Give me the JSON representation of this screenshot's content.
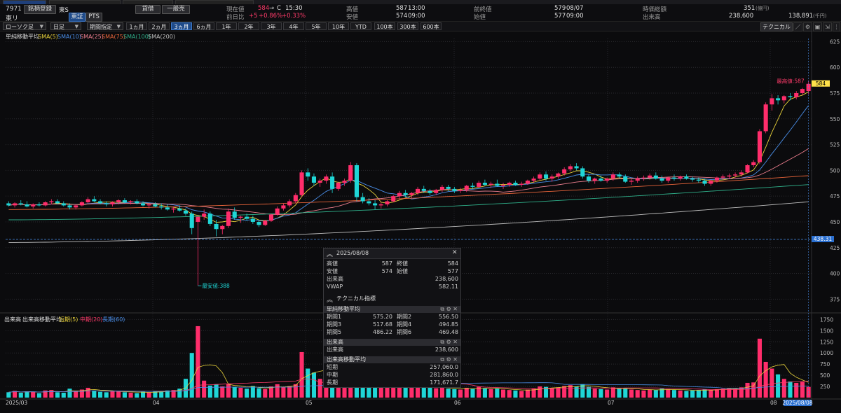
{
  "header": {
    "code": "7971",
    "name": "東リ",
    "watch_button": "銘柄登録",
    "market_short": "東S",
    "market_toggle": [
      "東証",
      "PTS"
    ],
    "trade_buttons": [
      "貸借",
      "一般売"
    ],
    "current_label": "現在値",
    "current_value": "584",
    "current_arrow": "→",
    "current_flag": "C",
    "current_time": "15:30",
    "change_label": "前日比",
    "change_value": "+5",
    "change_pct1": "+0.86%",
    "change_pct2": "+0.33%",
    "high_label": "高値",
    "high_value": "587",
    "high_time": "13:00",
    "low_label": "安値",
    "low_value": "574",
    "low_time": "09:00",
    "prev_close_label": "前終値",
    "prev_close_value": "579",
    "prev_close_date": "08/07",
    "open_label": "始値",
    "open_value": "577",
    "open_time": "09:00",
    "mktcap_label": "時価総額",
    "mktcap_value": "351",
    "mktcap_unit": "(億円)",
    "volume_label": "出来高",
    "volume_value": "238,600",
    "turnover_value": "138,891",
    "turnover_unit": "(千円)"
  },
  "controls": {
    "chart_type": "ローソク足",
    "interval": "日足",
    "range_mode": "期間指定",
    "periods": [
      "1ヵ月",
      "2ヵ月",
      "3ヵ月",
      "6ヵ月",
      "1年",
      "2年",
      "3年",
      "4年",
      "5年",
      "10年",
      "YTD",
      "100本",
      "300本",
      "600本"
    ],
    "active_period": "3ヵ月",
    "tech_button": "テクニカル"
  },
  "price_panel": {
    "title": "単純移動平均",
    "legend": [
      {
        "label": "SMA(5)",
        "color": "#e8d23a"
      },
      {
        "label": "SMA(10)",
        "color": "#4a8ee8"
      },
      {
        "label": "SMA(25)",
        "color": "#ee7f8f"
      },
      {
        "label": "SMA(75)",
        "color": "#e8643a"
      },
      {
        "label": "SMA(100)",
        "color": "#2fb08a"
      },
      {
        "label": "SMA(200)",
        "color": "#bdbdbd"
      }
    ],
    "high_note": "最高値:587",
    "low_note": "最安値:388",
    "last_price_tag": "584",
    "crosshair_tag": "438.31"
  },
  "volume_panel": {
    "title": "出来高",
    "legend_title": "出来高移動平均",
    "legend": [
      {
        "label": "短期(5)",
        "color": "#e8d23a"
      },
      {
        "label": "中期(20)",
        "color": "#ff3b6a"
      },
      {
        "label": "長期(60)",
        "color": "#4a8ee8"
      }
    ]
  },
  "x_labels": [
    "2025/03",
    "04",
    "05",
    "06",
    "07",
    "08"
  ],
  "x_cursor_tag": "2025/08/08",
  "popup": {
    "date": "2025/08/08",
    "high_label": "高値",
    "high": "587",
    "close_label": "終値",
    "close": "584",
    "low_label": "安値",
    "low": "574",
    "open_label": "始値",
    "open": "577",
    "volume_label": "出来高",
    "volume": "238,600",
    "vwap_label": "VWAP",
    "vwap": "582.11",
    "tech_title": "テクニカル指標",
    "sma_title": "単純移動平均",
    "sma_rows": [
      {
        "l1": "期間1",
        "v1": "575.20",
        "l2": "期間2",
        "v2": "556.50"
      },
      {
        "l1": "期間3",
        "v1": "517.68",
        "l2": "期間4",
        "v2": "494.85"
      },
      {
        "l1": "期間5",
        "v1": "486.22",
        "l2": "期間6",
        "v2": "469.48"
      }
    ],
    "vol_title": "出来高",
    "vol_label": "出来高",
    "vol_value": "238,600",
    "vma_title": "出来高移動平均",
    "vma_rows": [
      {
        "l": "短期",
        "v": "257,060.0"
      },
      {
        "l": "中期",
        "v": "281,860.0"
      },
      {
        "l": "長期",
        "v": "171,671.7"
      }
    ]
  },
  "chart_data": {
    "type": "candlestick",
    "price_ylim": [
      363,
      628
    ],
    "price_ticks": [
      375,
      400,
      425,
      450,
      475,
      500,
      525,
      550,
      575,
      600,
      625
    ],
    "volume_ylim": [
      0,
      1850
    ],
    "volume_ticks": [
      250,
      500,
      750,
      1000,
      1250,
      1500,
      1750
    ],
    "candles": [
      {
        "o": 468,
        "h": 470,
        "l": 465,
        "c": 466,
        "v": 120
      },
      {
        "o": 466,
        "h": 469,
        "l": 464,
        "c": 468,
        "v": 150
      },
      {
        "o": 468,
        "h": 471,
        "l": 466,
        "c": 467,
        "v": 110
      },
      {
        "o": 467,
        "h": 470,
        "l": 464,
        "c": 465,
        "v": 140
      },
      {
        "o": 465,
        "h": 468,
        "l": 463,
        "c": 467,
        "v": 130
      },
      {
        "o": 467,
        "h": 469,
        "l": 465,
        "c": 466,
        "v": 100
      },
      {
        "o": 466,
        "h": 470,
        "l": 465,
        "c": 469,
        "v": 160
      },
      {
        "o": 469,
        "h": 472,
        "l": 467,
        "c": 470,
        "v": 170
      },
      {
        "o": 470,
        "h": 472,
        "l": 467,
        "c": 468,
        "v": 120
      },
      {
        "o": 468,
        "h": 470,
        "l": 465,
        "c": 466,
        "v": 110
      },
      {
        "o": 466,
        "h": 468,
        "l": 462,
        "c": 464,
        "v": 200
      },
      {
        "o": 464,
        "h": 467,
        "l": 462,
        "c": 466,
        "v": 150
      },
      {
        "o": 466,
        "h": 470,
        "l": 465,
        "c": 469,
        "v": 180
      },
      {
        "o": 469,
        "h": 474,
        "l": 468,
        "c": 472,
        "v": 220
      },
      {
        "o": 472,
        "h": 475,
        "l": 469,
        "c": 470,
        "v": 160
      },
      {
        "o": 470,
        "h": 472,
        "l": 467,
        "c": 468,
        "v": 130
      },
      {
        "o": 468,
        "h": 470,
        "l": 465,
        "c": 467,
        "v": 120
      },
      {
        "o": 467,
        "h": 470,
        "l": 465,
        "c": 469,
        "v": 140
      },
      {
        "o": 469,
        "h": 472,
        "l": 467,
        "c": 471,
        "v": 150
      },
      {
        "o": 471,
        "h": 473,
        "l": 468,
        "c": 469,
        "v": 120
      },
      {
        "o": 469,
        "h": 471,
        "l": 467,
        "c": 470,
        "v": 110
      },
      {
        "o": 470,
        "h": 472,
        "l": 467,
        "c": 468,
        "v": 100
      },
      {
        "o": 468,
        "h": 470,
        "l": 465,
        "c": 466,
        "v": 130
      },
      {
        "o": 466,
        "h": 468,
        "l": 463,
        "c": 467,
        "v": 120
      },
      {
        "o": 467,
        "h": 469,
        "l": 464,
        "c": 465,
        "v": 150
      },
      {
        "o": 465,
        "h": 468,
        "l": 462,
        "c": 464,
        "v": 140
      },
      {
        "o": 464,
        "h": 467,
        "l": 461,
        "c": 462,
        "v": 160
      },
      {
        "o": 462,
        "h": 465,
        "l": 459,
        "c": 463,
        "v": 170
      },
      {
        "o": 463,
        "h": 466,
        "l": 460,
        "c": 461,
        "v": 200
      },
      {
        "o": 461,
        "h": 463,
        "l": 456,
        "c": 458,
        "v": 420
      },
      {
        "o": 458,
        "h": 460,
        "l": 438,
        "c": 444,
        "v": 1000
      },
      {
        "o": 450,
        "h": 455,
        "l": 388,
        "c": 455,
        "v": 1600
      },
      {
        "o": 455,
        "h": 462,
        "l": 452,
        "c": 458,
        "v": 380
      },
      {
        "o": 458,
        "h": 460,
        "l": 446,
        "c": 448,
        "v": 270
      },
      {
        "o": 448,
        "h": 452,
        "l": 436,
        "c": 443,
        "v": 300
      },
      {
        "o": 443,
        "h": 447,
        "l": 438,
        "c": 446,
        "v": 250
      },
      {
        "o": 446,
        "h": 463,
        "l": 444,
        "c": 460,
        "v": 300
      },
      {
        "o": 460,
        "h": 464,
        "l": 452,
        "c": 454,
        "v": 240
      },
      {
        "o": 454,
        "h": 456,
        "l": 449,
        "c": 455,
        "v": 220
      },
      {
        "o": 455,
        "h": 458,
        "l": 451,
        "c": 453,
        "v": 200
      },
      {
        "o": 453,
        "h": 456,
        "l": 448,
        "c": 450,
        "v": 260
      },
      {
        "o": 450,
        "h": 452,
        "l": 445,
        "c": 447,
        "v": 210
      },
      {
        "o": 447,
        "h": 452,
        "l": 446,
        "c": 451,
        "v": 190
      },
      {
        "o": 451,
        "h": 458,
        "l": 450,
        "c": 457,
        "v": 250
      },
      {
        "o": 457,
        "h": 465,
        "l": 456,
        "c": 463,
        "v": 300
      },
      {
        "o": 463,
        "h": 468,
        "l": 461,
        "c": 466,
        "v": 240
      },
      {
        "o": 466,
        "h": 472,
        "l": 464,
        "c": 470,
        "v": 260
      },
      {
        "o": 470,
        "h": 478,
        "l": 468,
        "c": 476,
        "v": 300
      },
      {
        "o": 476,
        "h": 500,
        "l": 474,
        "c": 498,
        "v": 1020
      },
      {
        "o": 498,
        "h": 502,
        "l": 490,
        "c": 494,
        "v": 650
      },
      {
        "o": 494,
        "h": 497,
        "l": 485,
        "c": 488,
        "v": 560
      },
      {
        "o": 488,
        "h": 492,
        "l": 484,
        "c": 490,
        "v": 420
      },
      {
        "o": 490,
        "h": 496,
        "l": 487,
        "c": 494,
        "v": 430
      },
      {
        "o": 494,
        "h": 498,
        "l": 478,
        "c": 482,
        "v": 480
      },
      {
        "o": 482,
        "h": 489,
        "l": 480,
        "c": 488,
        "v": 420
      },
      {
        "o": 488,
        "h": 492,
        "l": 485,
        "c": 490,
        "v": 360
      },
      {
        "o": 490,
        "h": 508,
        "l": 488,
        "c": 505,
        "v": 600
      },
      {
        "o": 505,
        "h": 507,
        "l": 470,
        "c": 474,
        "v": 900
      },
      {
        "o": 474,
        "h": 478,
        "l": 468,
        "c": 470,
        "v": 450
      },
      {
        "o": 470,
        "h": 473,
        "l": 466,
        "c": 468,
        "v": 300
      },
      {
        "o": 468,
        "h": 471,
        "l": 462,
        "c": 466,
        "v": 280
      },
      {
        "o": 466,
        "h": 469,
        "l": 463,
        "c": 467,
        "v": 250
      },
      {
        "o": 467,
        "h": 471,
        "l": 465,
        "c": 470,
        "v": 240
      },
      {
        "o": 470,
        "h": 476,
        "l": 469,
        "c": 475,
        "v": 260
      },
      {
        "o": 475,
        "h": 480,
        "l": 472,
        "c": 478,
        "v": 280
      },
      {
        "o": 478,
        "h": 481,
        "l": 474,
        "c": 476,
        "v": 250
      },
      {
        "o": 476,
        "h": 479,
        "l": 473,
        "c": 478,
        "v": 230
      },
      {
        "o": 478,
        "h": 484,
        "l": 476,
        "c": 482,
        "v": 260
      },
      {
        "o": 482,
        "h": 485,
        "l": 478,
        "c": 480,
        "v": 240
      },
      {
        "o": 480,
        "h": 482,
        "l": 476,
        "c": 478,
        "v": 220
      },
      {
        "o": 478,
        "h": 482,
        "l": 476,
        "c": 481,
        "v": 210
      },
      {
        "o": 481,
        "h": 486,
        "l": 479,
        "c": 484,
        "v": 230
      },
      {
        "o": 484,
        "h": 486,
        "l": 480,
        "c": 482,
        "v": 200
      },
      {
        "o": 482,
        "h": 484,
        "l": 478,
        "c": 480,
        "v": 190
      },
      {
        "o": 480,
        "h": 483,
        "l": 478,
        "c": 481,
        "v": 180
      },
      {
        "o": 481,
        "h": 486,
        "l": 479,
        "c": 485,
        "v": 220
      },
      {
        "o": 485,
        "h": 488,
        "l": 482,
        "c": 484,
        "v": 200
      },
      {
        "o": 484,
        "h": 490,
        "l": 483,
        "c": 488,
        "v": 240
      },
      {
        "o": 488,
        "h": 491,
        "l": 485,
        "c": 486,
        "v": 210
      },
      {
        "o": 486,
        "h": 489,
        "l": 483,
        "c": 487,
        "v": 190
      },
      {
        "o": 487,
        "h": 491,
        "l": 484,
        "c": 485,
        "v": 200
      },
      {
        "o": 485,
        "h": 488,
        "l": 482,
        "c": 486,
        "v": 180
      },
      {
        "o": 486,
        "h": 489,
        "l": 484,
        "c": 488,
        "v": 170
      },
      {
        "o": 488,
        "h": 490,
        "l": 485,
        "c": 486,
        "v": 160
      },
      {
        "o": 486,
        "h": 489,
        "l": 484,
        "c": 487,
        "v": 150
      },
      {
        "o": 487,
        "h": 491,
        "l": 486,
        "c": 490,
        "v": 180
      },
      {
        "o": 490,
        "h": 494,
        "l": 488,
        "c": 492,
        "v": 200
      },
      {
        "o": 492,
        "h": 498,
        "l": 490,
        "c": 496,
        "v": 250
      },
      {
        "o": 496,
        "h": 499,
        "l": 490,
        "c": 492,
        "v": 240
      },
      {
        "o": 492,
        "h": 496,
        "l": 489,
        "c": 494,
        "v": 210
      },
      {
        "o": 494,
        "h": 498,
        "l": 492,
        "c": 497,
        "v": 230
      },
      {
        "o": 497,
        "h": 503,
        "l": 495,
        "c": 501,
        "v": 260
      },
      {
        "o": 501,
        "h": 506,
        "l": 499,
        "c": 504,
        "v": 280
      },
      {
        "o": 504,
        "h": 507,
        "l": 500,
        "c": 502,
        "v": 250
      },
      {
        "o": 502,
        "h": 504,
        "l": 492,
        "c": 494,
        "v": 300
      },
      {
        "o": 494,
        "h": 496,
        "l": 488,
        "c": 490,
        "v": 240
      },
      {
        "o": 490,
        "h": 493,
        "l": 487,
        "c": 492,
        "v": 200
      },
      {
        "o": 492,
        "h": 495,
        "l": 489,
        "c": 490,
        "v": 190
      },
      {
        "o": 490,
        "h": 493,
        "l": 488,
        "c": 492,
        "v": 180
      },
      {
        "o": 492,
        "h": 498,
        "l": 490,
        "c": 496,
        "v": 230
      },
      {
        "o": 496,
        "h": 498,
        "l": 492,
        "c": 494,
        "v": 200
      },
      {
        "o": 494,
        "h": 496,
        "l": 488,
        "c": 489,
        "v": 210
      },
      {
        "o": 489,
        "h": 492,
        "l": 486,
        "c": 490,
        "v": 180
      },
      {
        "o": 490,
        "h": 494,
        "l": 488,
        "c": 492,
        "v": 170
      },
      {
        "o": 492,
        "h": 495,
        "l": 490,
        "c": 493,
        "v": 160
      },
      {
        "o": 493,
        "h": 497,
        "l": 491,
        "c": 495,
        "v": 180
      },
      {
        "o": 495,
        "h": 498,
        "l": 491,
        "c": 492,
        "v": 170
      },
      {
        "o": 492,
        "h": 495,
        "l": 488,
        "c": 490,
        "v": 200
      },
      {
        "o": 490,
        "h": 494,
        "l": 488,
        "c": 493,
        "v": 190
      },
      {
        "o": 493,
        "h": 496,
        "l": 490,
        "c": 492,
        "v": 170
      },
      {
        "o": 492,
        "h": 495,
        "l": 490,
        "c": 494,
        "v": 160
      },
      {
        "o": 494,
        "h": 496,
        "l": 491,
        "c": 492,
        "v": 150
      },
      {
        "o": 492,
        "h": 494,
        "l": 489,
        "c": 491,
        "v": 160
      },
      {
        "o": 491,
        "h": 493,
        "l": 488,
        "c": 490,
        "v": 170
      },
      {
        "o": 490,
        "h": 492,
        "l": 485,
        "c": 487,
        "v": 180
      },
      {
        "o": 487,
        "h": 491,
        "l": 485,
        "c": 490,
        "v": 170
      },
      {
        "o": 490,
        "h": 494,
        "l": 488,
        "c": 493,
        "v": 190
      },
      {
        "o": 493,
        "h": 496,
        "l": 491,
        "c": 494,
        "v": 200
      },
      {
        "o": 494,
        "h": 497,
        "l": 492,
        "c": 495,
        "v": 210
      },
      {
        "o": 495,
        "h": 498,
        "l": 493,
        "c": 496,
        "v": 200
      },
      {
        "o": 496,
        "h": 500,
        "l": 494,
        "c": 498,
        "v": 230
      },
      {
        "o": 498,
        "h": 506,
        "l": 497,
        "c": 505,
        "v": 330
      },
      {
        "o": 505,
        "h": 510,
        "l": 503,
        "c": 508,
        "v": 340
      },
      {
        "o": 508,
        "h": 540,
        "l": 506,
        "c": 538,
        "v": 1320
      },
      {
        "o": 538,
        "h": 566,
        "l": 536,
        "c": 564,
        "v": 800
      },
      {
        "o": 564,
        "h": 574,
        "l": 558,
        "c": 570,
        "v": 650
      },
      {
        "o": 570,
        "h": 573,
        "l": 564,
        "c": 568,
        "v": 520
      },
      {
        "o": 568,
        "h": 573,
        "l": 565,
        "c": 572,
        "v": 420
      },
      {
        "o": 572,
        "h": 575,
        "l": 568,
        "c": 571,
        "v": 360
      },
      {
        "o": 571,
        "h": 577,
        "l": 569,
        "c": 575,
        "v": 330
      },
      {
        "o": 575,
        "h": 580,
        "l": 573,
        "c": 579,
        "v": 350
      },
      {
        "o": 577,
        "h": 587,
        "l": 574,
        "c": 584,
        "v": 240
      }
    ]
  }
}
